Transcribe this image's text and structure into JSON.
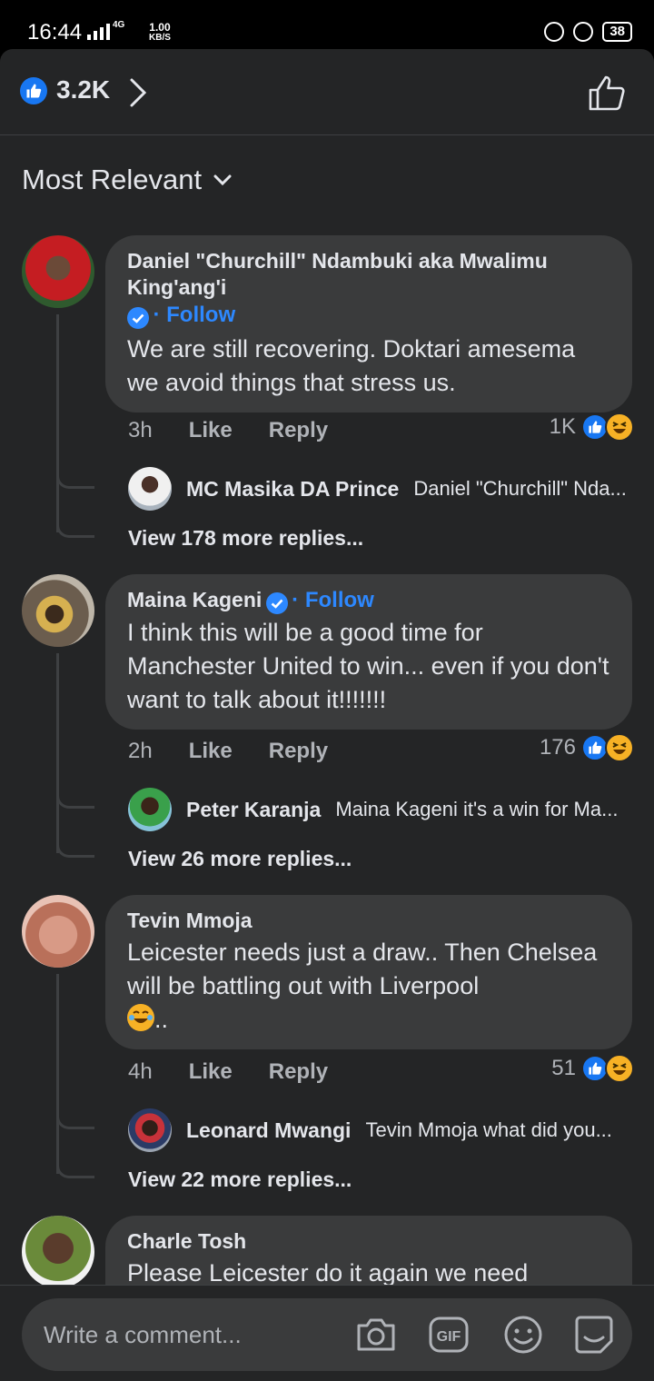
{
  "status_bar": {
    "time": "16:44",
    "network": "4G",
    "speed_value": "1.00",
    "speed_unit": "KB/S",
    "battery": "38"
  },
  "header": {
    "reaction_count": "3.2K",
    "icons": [
      "like-badge-icon",
      "chevron-right-icon",
      "thumbs-up-outline-icon"
    ]
  },
  "filter": {
    "label": "Most Relevant"
  },
  "comments": [
    {
      "author_line1": "Daniel \"Churchill\" Ndambuki aka Mwalimu",
      "author_line2": "King'ang'i",
      "follow": "Follow",
      "text": "We are still recovering. Doktari amesema we avoid things that stress us.",
      "time": "3h",
      "like": "Like",
      "reply": "Reply",
      "reactions": "1K",
      "reply_preview": {
        "name": "MC Masika DA Prince",
        "snippet": "Daniel \"Churchill\" Nda..."
      },
      "more_replies": "View 178 more replies..."
    },
    {
      "author": "Maina Kageni",
      "follow": "Follow",
      "text": "I think this will be a good time for Manchester United to win... even if you don't want to talk about it!!!!!!!",
      "time": "2h",
      "like": "Like",
      "reply": "Reply",
      "reactions": "176",
      "reply_preview": {
        "name": "Peter Karanja",
        "snippet": "Maina Kageni it's a win for Ma..."
      },
      "more_replies": "View 26 more replies..."
    },
    {
      "author": "Tevin Mmoja",
      "text": "Leicester needs just a draw.. Then Chelsea will be battling out with Liverpool",
      "text_tail": "..",
      "time": "4h",
      "like": "Like",
      "reply": "Reply",
      "reactions": "51",
      "reply_preview": {
        "name": "Leonard Mwangi",
        "snippet": "Tevin Mmoja what did you..."
      },
      "more_replies": "View 22 more replies..."
    },
    {
      "author": "Charle Tosh",
      "text": "Please Leicester do it again we need"
    }
  ],
  "composer": {
    "placeholder": "Write a comment...",
    "icons": [
      "camera-icon",
      "gif-icon",
      "emoji-icon",
      "sticker-icon"
    ]
  },
  "colors": {
    "background": "#242526",
    "bubble": "#3a3b3c",
    "accent": "#2d88ff",
    "like_blue": "#1877f2"
  }
}
